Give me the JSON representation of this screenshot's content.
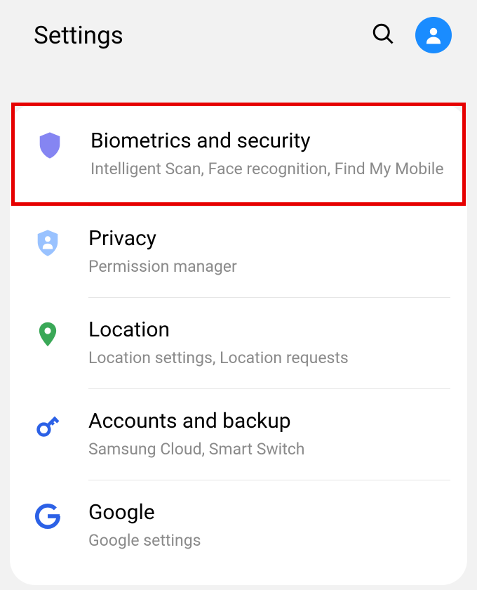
{
  "header": {
    "title": "Settings"
  },
  "items": [
    {
      "title": "Biometrics and security",
      "subtitle": "Intelligent Scan, Face recognition, Find My Mobile"
    },
    {
      "title": "Privacy",
      "subtitle": "Permission manager"
    },
    {
      "title": "Location",
      "subtitle": "Location settings, Location requests"
    },
    {
      "title": "Accounts and backup",
      "subtitle": "Samsung Cloud, Smart Switch"
    },
    {
      "title": "Google",
      "subtitle": "Google settings"
    }
  ]
}
